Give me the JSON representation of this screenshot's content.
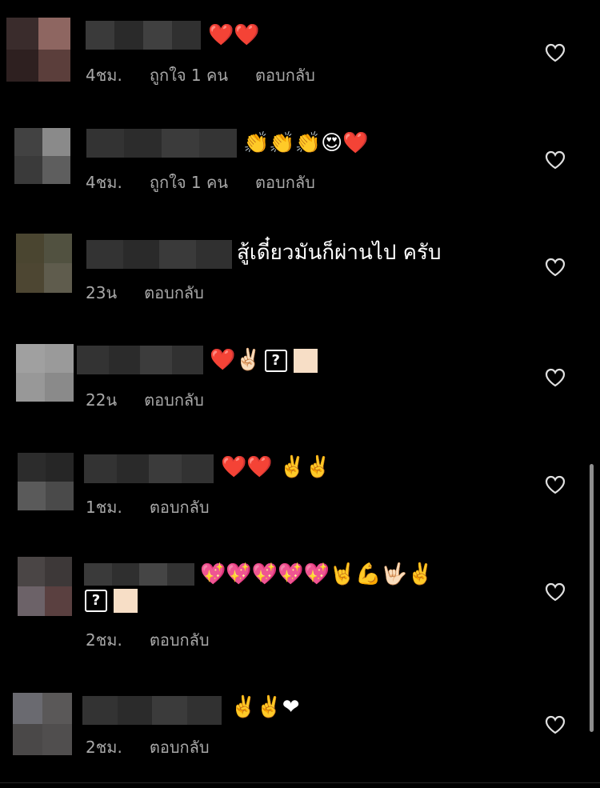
{
  "ui": {
    "heart_color": "#e0e0e0",
    "meta_color": "#a8a8a8",
    "background": "#000000"
  },
  "comments": [
    {
      "text": "❤️❤️",
      "time": "4ชม.",
      "likes": "ถูกใจ 1 คน",
      "reply": "ตอบกลับ"
    },
    {
      "text": "👏👏👏😍❤️",
      "time": "4ชม.",
      "likes": "ถูกใจ 1 คน",
      "reply": "ตอบกลับ"
    },
    {
      "text": "สู้เดี๋ยวมันก็ผ่านไป ครับ",
      "time": "23น",
      "reply": "ตอบกลับ"
    },
    {
      "text": "❤️✌🏻",
      "time": "22น",
      "reply": "ตอบกลับ"
    },
    {
      "text": "❤️❤️ ✌️✌️",
      "time": "1ชม.",
      "reply": "ตอบกลับ"
    },
    {
      "text": "💖💖💖💖💖🤘💪🤟🏻✌️",
      "time": "2ชม.",
      "reply": "ตอบกลับ"
    },
    {
      "text": "✌️✌️❤",
      "time": "2ชม.",
      "reply": "ตอบกลับ"
    }
  ]
}
